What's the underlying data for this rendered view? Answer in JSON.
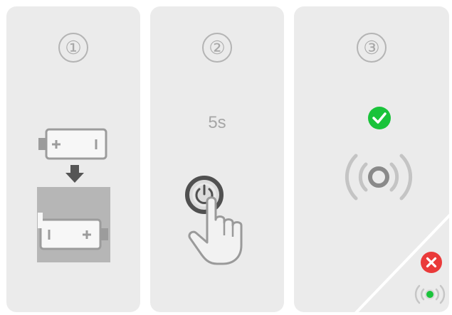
{
  "steps": [
    {
      "number": "①",
      "illustration": "battery-insert-icon"
    },
    {
      "number": "②",
      "duration_label": "5s",
      "illustration": "press-power-button-icon"
    },
    {
      "number": "③",
      "success_indicator": "check-circle-icon",
      "success_signal": "broadcast-signal-icon",
      "error_indicator": "close-circle-icon",
      "error_signal": "signal-green-dot-icon"
    }
  ],
  "colors": {
    "panel_background": "#ebebeb",
    "icon_gray": "#9c9c9c",
    "success_green": "#19c33a",
    "error_red": "#ea3a3a"
  }
}
